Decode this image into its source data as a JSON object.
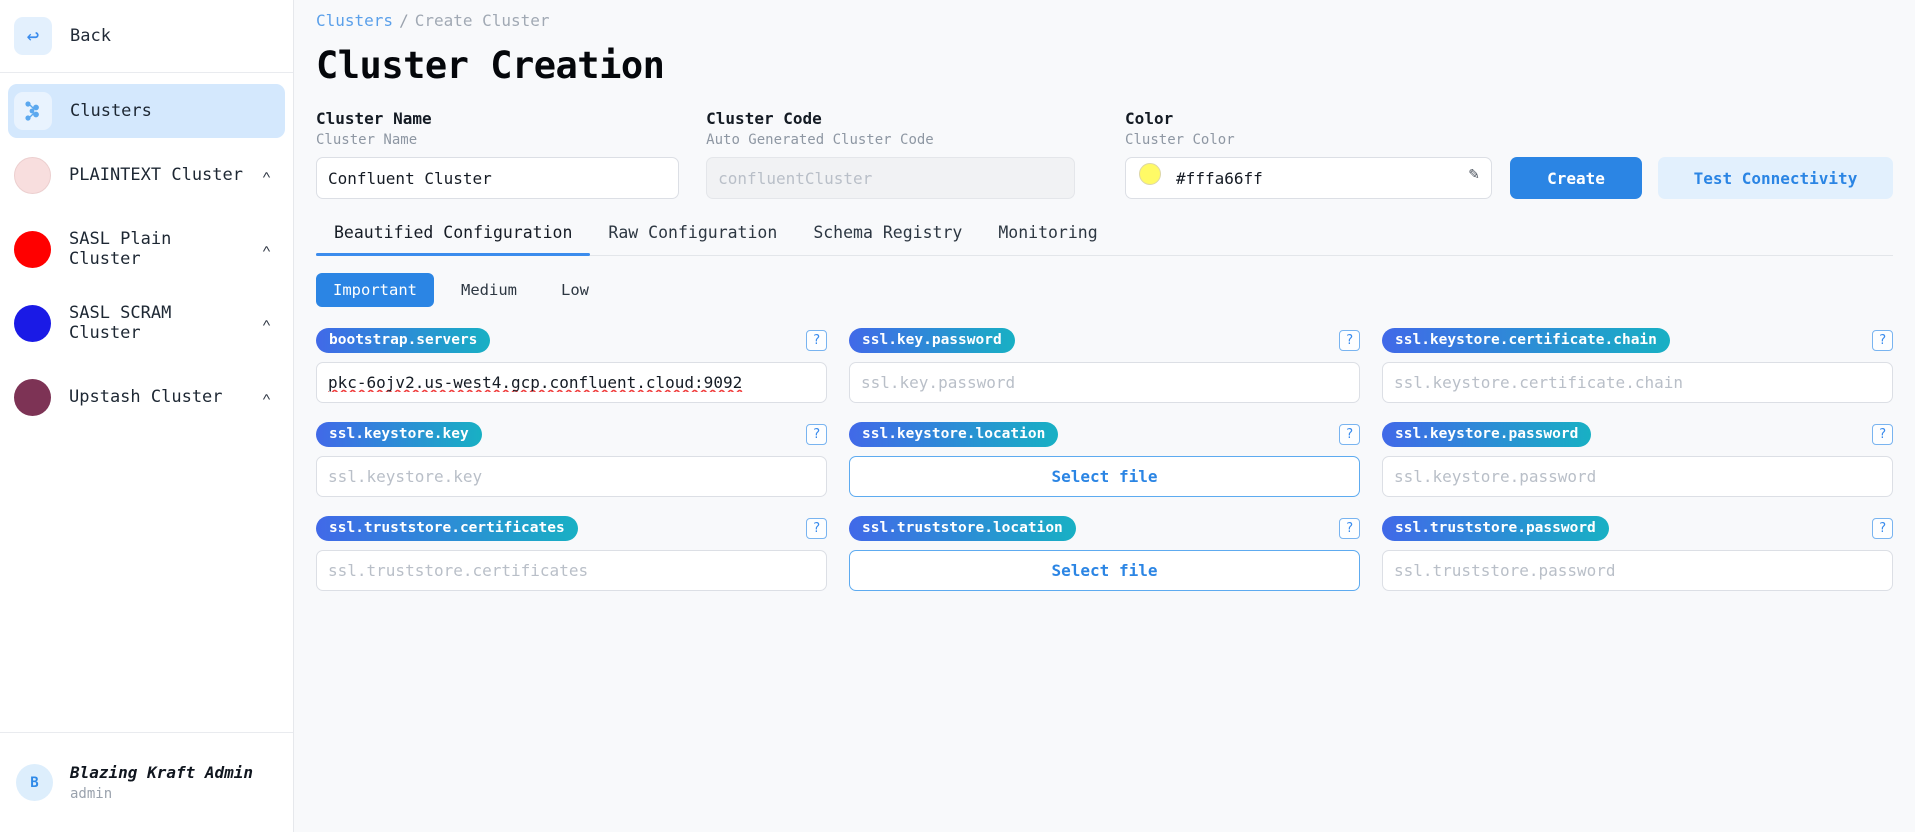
{
  "sidebar": {
    "back": {
      "label": "Back",
      "icon": "back-arrow-icon"
    },
    "nav": {
      "label": "Clusters",
      "icon": "kafka-clusters-icon"
    },
    "clusters": [
      {
        "name": "PLAINTEXT Cluster",
        "color": "#f8dede",
        "chevron": "˄"
      },
      {
        "name": "SASL Plain Cluster",
        "color": "#ff0000",
        "chevron": "˄"
      },
      {
        "name": "SASL SCRAM Cluster",
        "color": "#1a1ae6",
        "chevron": "˄"
      },
      {
        "name": "Upstash Cluster",
        "color": "#7d3355",
        "chevron": "˄"
      }
    ],
    "user": {
      "initial": "B",
      "name": "Blazing Kraft Admin",
      "role": "admin"
    }
  },
  "breadcrumb": {
    "parent": "Clusters",
    "separator": "/",
    "current": "Create Cluster"
  },
  "page_title": "Cluster Creation",
  "form": {
    "cluster_name": {
      "title": "Cluster Name",
      "subtitle": "Cluster Name",
      "value": "Confluent Cluster",
      "placeholder": "Cluster Name"
    },
    "cluster_code": {
      "title": "Cluster Code",
      "subtitle": "Auto Generated Cluster Code",
      "value": "",
      "placeholder": "confluentCluster"
    },
    "color": {
      "title": "Color",
      "subtitle": "Cluster Color",
      "value": "#fffa66ff",
      "swatch": "#fffa66",
      "edit_icon": "pencil-icon"
    },
    "create_button": "Create",
    "test_button": "Test Connectivity"
  },
  "tabs": [
    {
      "label": "Beautified Configuration",
      "active": true
    },
    {
      "label": "Raw Configuration",
      "active": false
    },
    {
      "label": "Schema Registry",
      "active": false
    },
    {
      "label": "Monitoring",
      "active": false
    }
  ],
  "severity": [
    {
      "label": "Important",
      "active": true
    },
    {
      "label": "Medium",
      "active": false
    },
    {
      "label": "Low",
      "active": false
    }
  ],
  "config_fields": [
    {
      "key": "bootstrap.servers",
      "type": "text",
      "value": "pkc-6ojv2.us-west4.gcp.confluent.cloud:9092",
      "placeholder": "bootstrap.servers",
      "help": "?"
    },
    {
      "key": "ssl.key.password",
      "type": "text",
      "value": "",
      "placeholder": "ssl.key.password",
      "help": "?"
    },
    {
      "key": "ssl.keystore.certificate.chain",
      "type": "text",
      "value": "",
      "placeholder": "ssl.keystore.certificate.chain",
      "help": "?"
    },
    {
      "key": "ssl.keystore.key",
      "type": "text",
      "value": "",
      "placeholder": "ssl.keystore.key",
      "help": "?"
    },
    {
      "key": "ssl.keystore.location",
      "type": "file",
      "value": "",
      "button_label": "Select file",
      "help": "?"
    },
    {
      "key": "ssl.keystore.password",
      "type": "text",
      "value": "",
      "placeholder": "ssl.keystore.password",
      "help": "?"
    },
    {
      "key": "ssl.truststore.certificates",
      "type": "text",
      "value": "",
      "placeholder": "ssl.truststore.certificates",
      "help": "?"
    },
    {
      "key": "ssl.truststore.location",
      "type": "file",
      "value": "",
      "button_label": "Select file",
      "help": "?"
    },
    {
      "key": "ssl.truststore.password",
      "type": "text",
      "value": "",
      "placeholder": "ssl.truststore.password",
      "help": "?"
    }
  ],
  "colors": {
    "accent": "#2b85e4",
    "accent_soft": "#e2f0fd",
    "pill_from": "#4169e8",
    "pill_to": "#18b0c4"
  }
}
